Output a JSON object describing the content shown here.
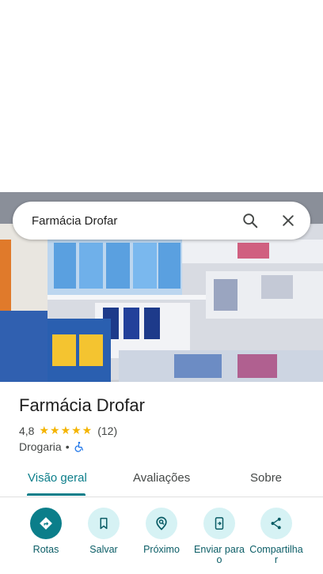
{
  "search": {
    "value": "Farmácia Drofar"
  },
  "place": {
    "name": "Farmácia Drofar",
    "rating": "4,8",
    "stars": "★★★★★",
    "review_count": "(12)",
    "category": "Drogaria",
    "separator": "•"
  },
  "tabs": [
    {
      "label": "Visão geral"
    },
    {
      "label": "Avaliações"
    },
    {
      "label": "Sobre"
    }
  ],
  "actions": [
    {
      "label": "Rotas"
    },
    {
      "label": "Salvar"
    },
    {
      "label": "Próximo"
    },
    {
      "label": "Enviar para o"
    },
    {
      "label": "Compartilha r"
    }
  ],
  "colors": {
    "accent": "#0b7e8a",
    "star": "#f4b400",
    "chip": "#d6f2f4"
  }
}
